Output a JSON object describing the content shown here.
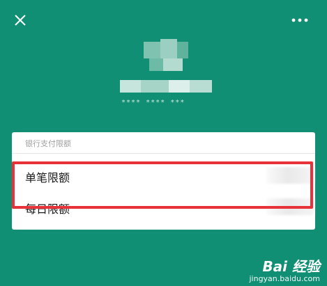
{
  "header": {
    "close_icon": "close-icon",
    "more_icon": "more-icon",
    "masked_card_number": "**** **** ***",
    "colors": {
      "background": "#118f74",
      "text_light": "#cfe9e1"
    }
  },
  "card": {
    "section_label": "银行支付限额",
    "rows": [
      {
        "label": "单笔限额"
      },
      {
        "label": "每日限额"
      }
    ]
  },
  "highlight": {
    "color": "#e8323a"
  },
  "watermark": {
    "logo": "Bai 经验",
    "url": "jingyan.baidu.com"
  }
}
